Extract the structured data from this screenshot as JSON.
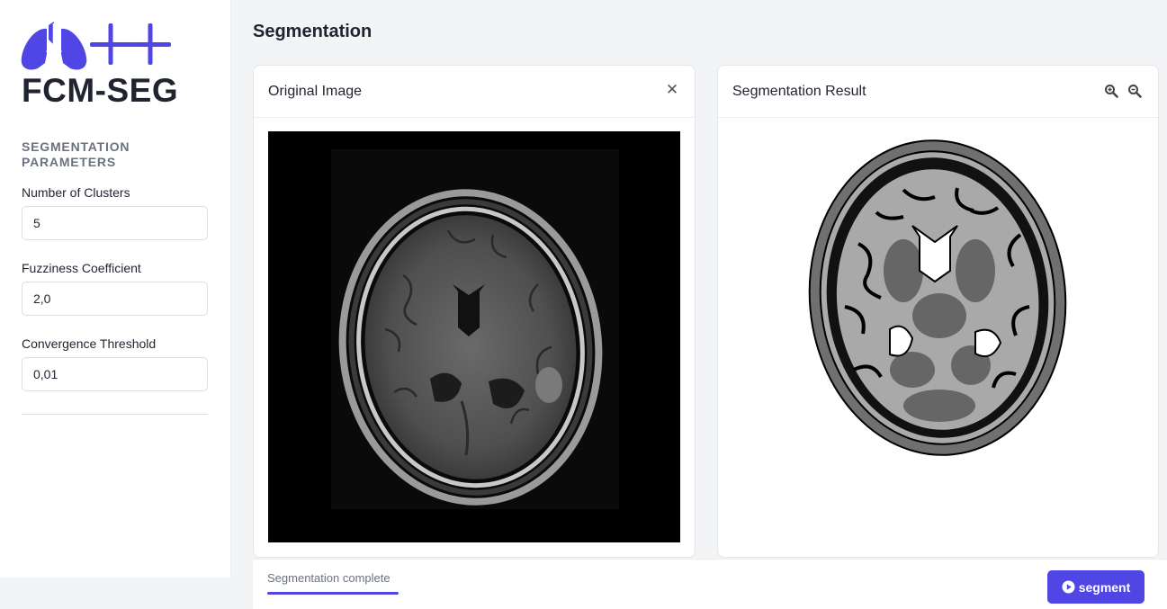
{
  "app": {
    "logo_text": "FCM-SEG",
    "logo_icon": "lungs-plus-plus-icon",
    "accent_color": "#4f46e5"
  },
  "sidebar": {
    "section_heading": "SEGMENTATION PARAMETERS",
    "fields": [
      {
        "label": "Number of Clusters",
        "value": "5"
      },
      {
        "label": "Fuzziness Coefficient",
        "value": "2,0"
      },
      {
        "label": "Convergence Threshold",
        "value": "0,01"
      }
    ]
  },
  "main": {
    "page_title": "Segmentation",
    "original_card": {
      "title": "Original Image",
      "close_icon": "close-icon"
    },
    "result_card": {
      "title": "Segmentation Result",
      "zoom_in_icon": "zoom-in-icon",
      "zoom_out_icon": "zoom-out-icon"
    }
  },
  "status_bar": {
    "status_text": "Segmentation complete",
    "segment_button_label": "segment",
    "segment_button_icon": "play-circle-icon"
  }
}
